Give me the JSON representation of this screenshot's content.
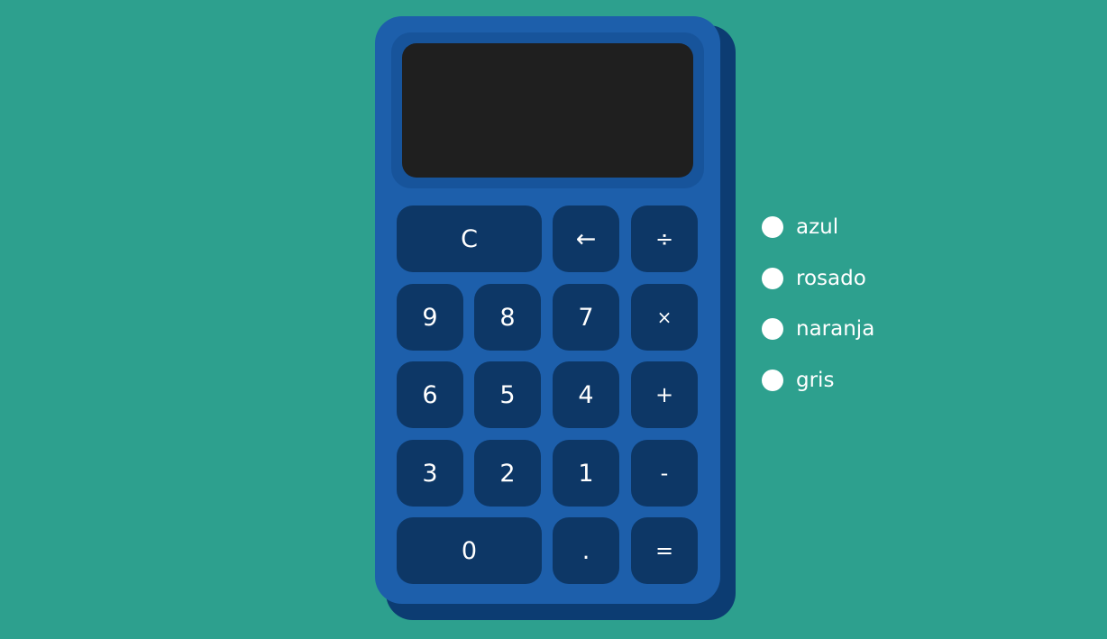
{
  "colors": {
    "background": "#2da08e",
    "calculator_body": "#1d5fab",
    "calculator_shadow": "#0c3c72",
    "display": "#1f1f1f",
    "key": "#0d3766",
    "text": "#ffffff"
  },
  "display": {
    "value": ""
  },
  "keys": {
    "clear": "C",
    "backspace": "←",
    "divide": "÷",
    "nine": "9",
    "eight": "8",
    "seven": "7",
    "multiply": "×",
    "six": "6",
    "five": "5",
    "four": "4",
    "plus": "+",
    "three": "3",
    "two": "2",
    "one": "1",
    "minus": "-",
    "zero": "0",
    "decimal": ".",
    "equals": "="
  },
  "themes": [
    {
      "label": "azul",
      "selected": false
    },
    {
      "label": "rosado",
      "selected": false
    },
    {
      "label": "naranja",
      "selected": false
    },
    {
      "label": "gris",
      "selected": false
    }
  ]
}
